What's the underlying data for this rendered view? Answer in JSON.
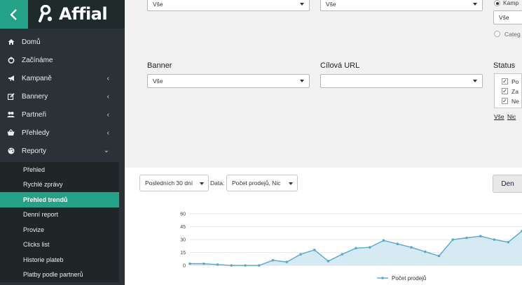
{
  "app": {
    "logo_text": "Affial"
  },
  "nav": [
    {
      "label": "Domů",
      "icon": "home-icon"
    },
    {
      "label": "Začínáme",
      "icon": "power-icon"
    },
    {
      "label": "Kampaně",
      "icon": "bullhorn-icon"
    },
    {
      "label": "Bannery",
      "icon": "edit-icon"
    },
    {
      "label": "Partneři",
      "icon": "users-icon"
    },
    {
      "label": "Přehledy",
      "icon": "basket-icon"
    },
    {
      "label": "Reporty",
      "icon": "palette-icon"
    }
  ],
  "submenu": [
    {
      "label": "Přehled"
    },
    {
      "label": "Rychlé zprávy"
    },
    {
      "label": "Přehled trendů"
    },
    {
      "label": "Denní report"
    },
    {
      "label": "Provize"
    },
    {
      "label": "Clicks list"
    },
    {
      "label": "Historie plateb"
    },
    {
      "label": "Platby podle partnerů"
    }
  ],
  "filters": {
    "top_select_1": "Vše",
    "top_select_2": "Vše",
    "campaign_radio_label": "Kamp",
    "campaign_select": "Vše",
    "category_radio_label": "Categ",
    "banner_label": "Banner",
    "banner_value": "Vše",
    "url_label": "Cílová URL",
    "url_value": "",
    "status_label": "Status",
    "status_items": [
      "Po",
      "Za",
      "Ne"
    ],
    "select_all": "Vše",
    "select_none": "Nic"
  },
  "chart_controls": {
    "period": "Posledních 30 dní",
    "data_label": "Data:",
    "data_value": "Počet prodejů, Nic",
    "granularity_button": "Den"
  },
  "colors": {
    "accent": "#24a288",
    "series": "#5aa9c9",
    "area": "#cfe6f1"
  },
  "chart_data": {
    "type": "area",
    "yticks": [
      "0",
      "15",
      "30",
      "45",
      "60"
    ],
    "ylim": [
      0,
      60
    ],
    "legend": "Počet prodejů",
    "series": [
      {
        "name": "Počet prodejů",
        "values": [
          2,
          2,
          1,
          0,
          0,
          0,
          6,
          4,
          13,
          18,
          5,
          13,
          20,
          21,
          29,
          25,
          21,
          16,
          11,
          30,
          32,
          34,
          30,
          27,
          40
        ]
      }
    ]
  }
}
